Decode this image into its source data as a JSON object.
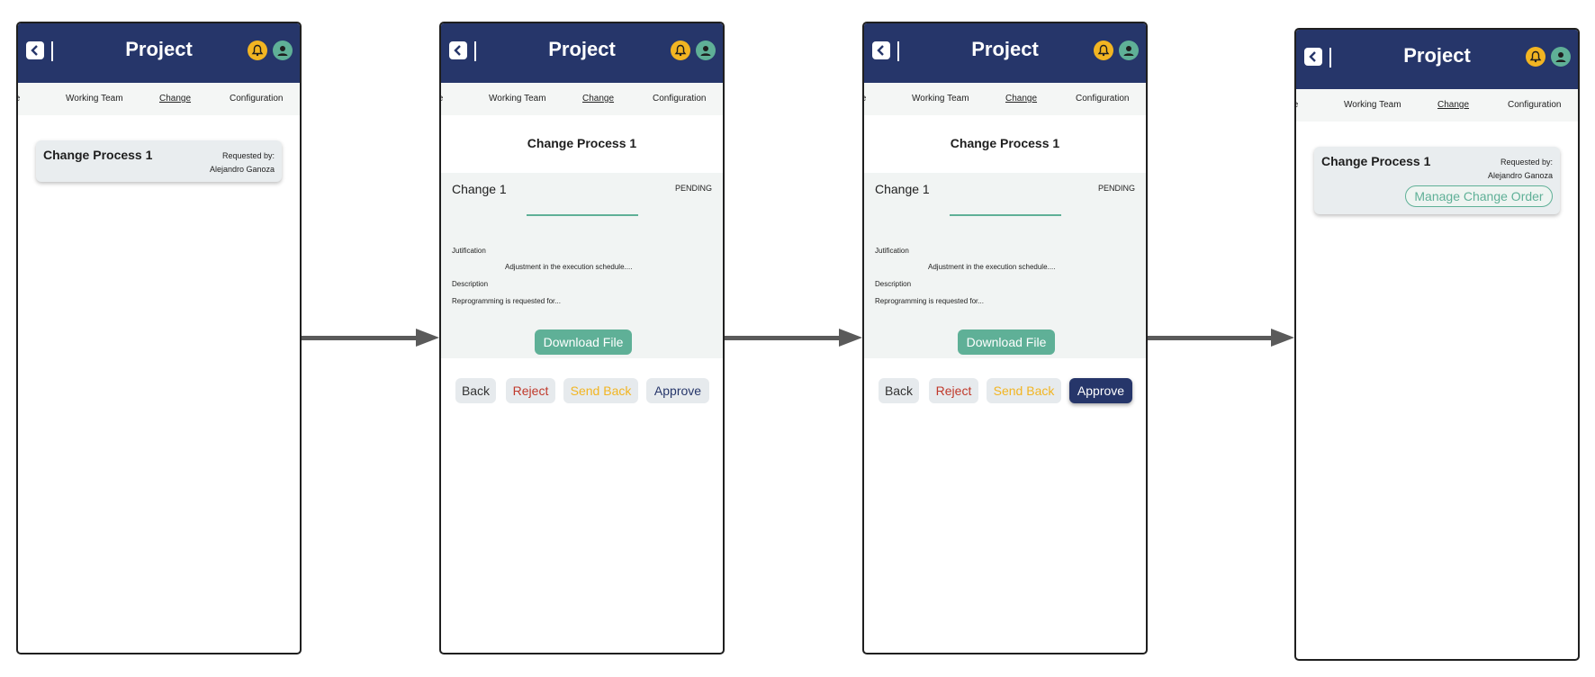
{
  "app": {
    "title": "Project"
  },
  "tabs": {
    "schedule": "ule",
    "team": "Working Team",
    "change": "Change",
    "config": "Configuration"
  },
  "card": {
    "title": "Change  Process 1",
    "requested_label": "Requested by:",
    "requested_name": "Alejandro Ganoza",
    "manage_label": "Manage Change Order"
  },
  "detail": {
    "title": "Change Process 1",
    "change_name": "Change 1",
    "status": "PENDING",
    "justification_label": "Jutification",
    "justification_text": "Adjustment in the execution schedule....",
    "description_label": "Description",
    "description_text": "Reprogramming is requested for...",
    "download_label": "Download File"
  },
  "actions": {
    "back": "Back",
    "reject": "Reject",
    "send_back": "Send Back",
    "approve": "Approve"
  },
  "colors": {
    "header": "#26366a",
    "accent_green": "#5fb097",
    "bell_yellow": "#f2b522",
    "reject_red": "#c0392b",
    "card_bg": "#e9edef",
    "arrow": "#5a5a5a"
  },
  "icons": {
    "back": "chevron-left-icon",
    "notifications": "bell-icon",
    "profile": "user-icon",
    "flow": "arrow-right-icon"
  }
}
